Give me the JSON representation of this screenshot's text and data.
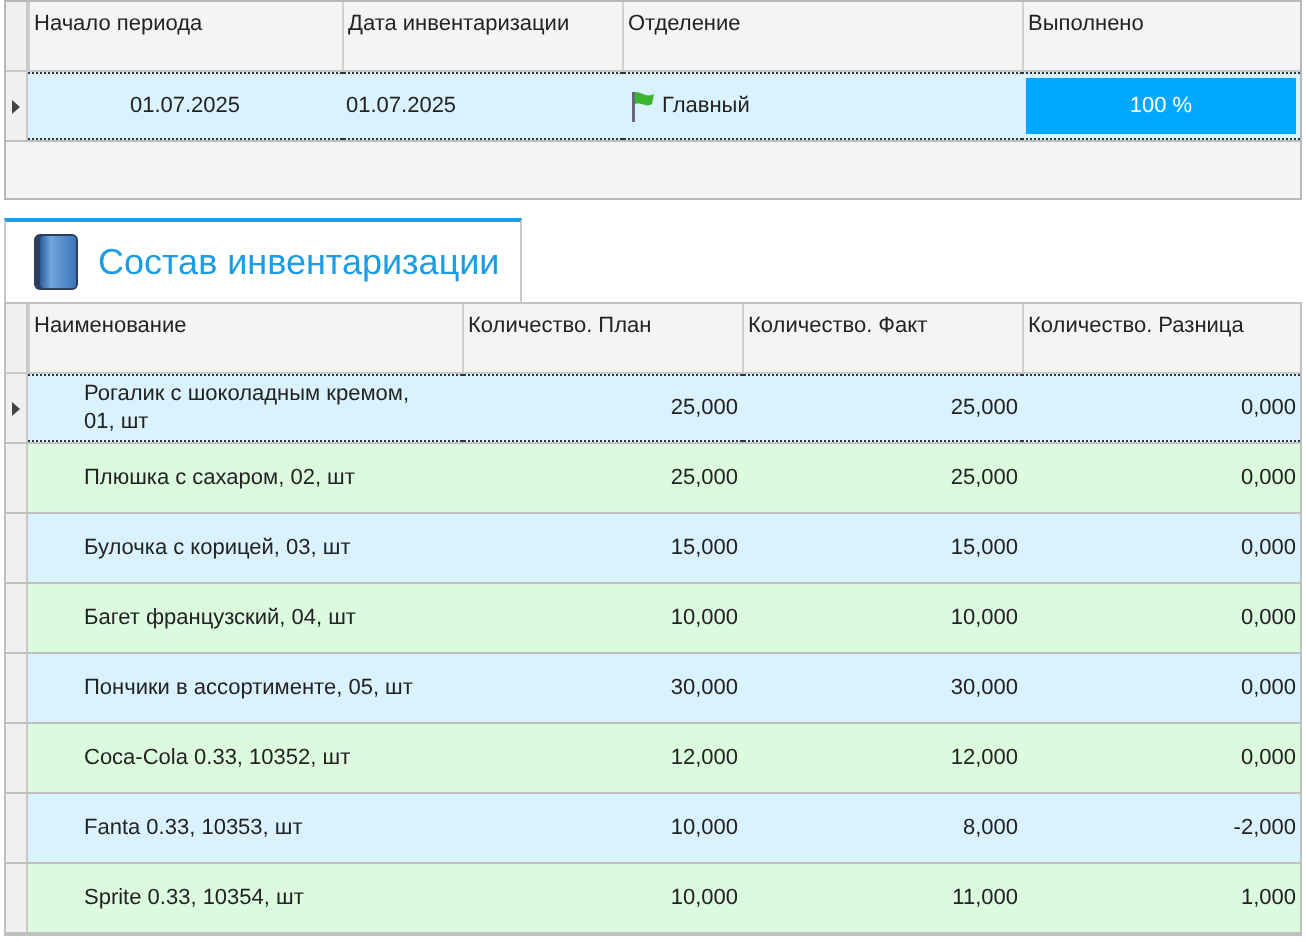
{
  "inventory_table": {
    "columns": [
      "Начало периода",
      "Дата инвентаризации",
      "Отделение",
      "Выполнено"
    ],
    "rows": [
      {
        "selected": true,
        "start": "01.07.2025",
        "date": "01.07.2025",
        "department": "Главный",
        "progress": {
          "level": 1,
          "reading": "100 %"
        }
      }
    ]
  },
  "tab": {
    "title": "Состав инвентаризации",
    "selected": true
  },
  "items_table": {
    "columns": [
      "Наименование",
      "Количество. План",
      "Количество. Факт",
      "Количество. Разница"
    ],
    "rows": [
      {
        "selected": true,
        "name": "Рогалик с шоколадным кремом, 01, шт",
        "plan": "25,000",
        "fact": "25,000",
        "diff": "0,000"
      },
      {
        "selected": false,
        "name": "Плюшка с сахаром, 02, шт",
        "plan": "25,000",
        "fact": "25,000",
        "diff": "0,000"
      },
      {
        "selected": false,
        "name": "Булочка с корицей, 03, шт",
        "plan": "15,000",
        "fact": "15,000",
        "diff": "0,000"
      },
      {
        "selected": false,
        "name": "Багет французский, 04, шт",
        "plan": "10,000",
        "fact": "10,000",
        "diff": "0,000"
      },
      {
        "selected": false,
        "name": "Пончики в ассортименте, 05, шт",
        "plan": "30,000",
        "fact": "30,000",
        "diff": "0,000"
      },
      {
        "selected": false,
        "name": "Coca-Cola 0.33, 10352, шт",
        "plan": "12,000",
        "fact": "12,000",
        "diff": "0,000"
      },
      {
        "selected": false,
        "name": "Fanta 0.33, 10353, шт",
        "plan": "10,000",
        "fact": "8,000",
        "diff": "-2,000"
      },
      {
        "selected": false,
        "name": "Sprite 0.33, 10354, шт",
        "plan": "10,000",
        "fact": "11,000",
        "diff": "1,000"
      }
    ]
  }
}
